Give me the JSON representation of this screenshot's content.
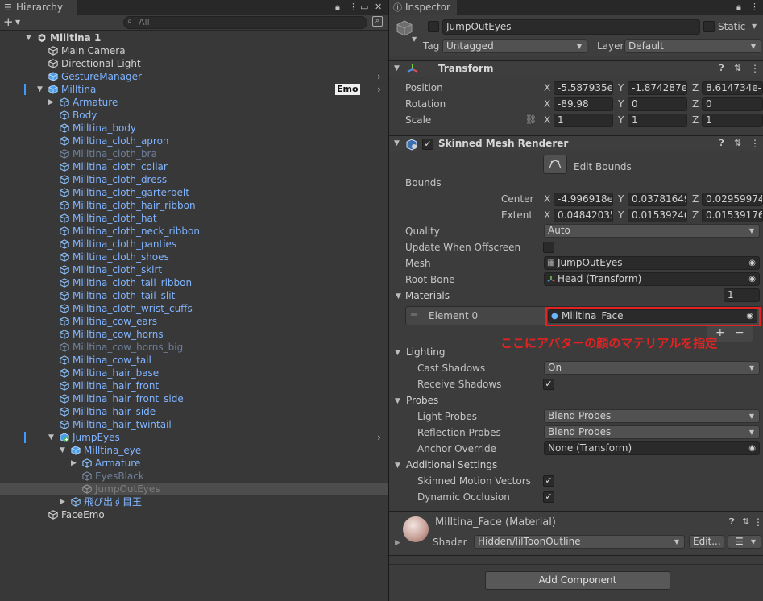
{
  "hierarchy": {
    "tab_title": "Hierarchy",
    "search_placeholder": "All",
    "badge": "Emo",
    "rows": [
      {
        "label": "Milltina 1",
        "indent": 0,
        "arrow": "down",
        "color": "white",
        "bold": true,
        "icon": "unity-scene-icon"
      },
      {
        "label": "Main Camera",
        "indent": 1,
        "arrow": "",
        "color": "white",
        "icon": "cube-outline-icon"
      },
      {
        "label": "Directional Light",
        "indent": 1,
        "arrow": "",
        "color": "white",
        "icon": "cube-outline-icon"
      },
      {
        "label": "GestureManager",
        "indent": 1,
        "arrow": "",
        "color": "blue",
        "icon": "cube-solid-icon",
        "chevron": true
      },
      {
        "label": "Milltina",
        "indent": 1,
        "arrow": "down",
        "color": "blue",
        "icon": "cube-solid-icon",
        "chevron": true,
        "badge": true,
        "marker": true
      },
      {
        "label": "Armature",
        "indent": 2,
        "arrow": "right",
        "color": "blue",
        "icon": "cube-outline-icon"
      },
      {
        "label": "Body",
        "indent": 2,
        "arrow": "",
        "color": "blue",
        "icon": "cube-outline-icon"
      },
      {
        "label": "Milltina_body",
        "indent": 2,
        "arrow": "",
        "color": "blue",
        "icon": "cube-outline-icon"
      },
      {
        "label": "Milltina_cloth_apron",
        "indent": 2,
        "arrow": "",
        "color": "blue",
        "icon": "cube-outline-icon"
      },
      {
        "label": "Milltina_cloth_bra",
        "indent": 2,
        "arrow": "",
        "color": "dim",
        "icon": "cube-outline-icon"
      },
      {
        "label": "Milltina_cloth_collar",
        "indent": 2,
        "arrow": "",
        "color": "blue",
        "icon": "cube-outline-icon"
      },
      {
        "label": "Milltina_cloth_dress",
        "indent": 2,
        "arrow": "",
        "color": "blue",
        "icon": "cube-outline-icon"
      },
      {
        "label": "Milltina_cloth_garterbelt",
        "indent": 2,
        "arrow": "",
        "color": "blue",
        "icon": "cube-outline-icon"
      },
      {
        "label": "Milltina_cloth_hair_ribbon",
        "indent": 2,
        "arrow": "",
        "color": "blue",
        "icon": "cube-outline-icon"
      },
      {
        "label": "Milltina_cloth_hat",
        "indent": 2,
        "arrow": "",
        "color": "blue",
        "icon": "cube-outline-icon"
      },
      {
        "label": "Milltina_cloth_neck_ribbon",
        "indent": 2,
        "arrow": "",
        "color": "blue",
        "icon": "cube-outline-icon"
      },
      {
        "label": "Milltina_cloth_panties",
        "indent": 2,
        "arrow": "",
        "color": "blue",
        "icon": "cube-outline-icon"
      },
      {
        "label": "Milltina_cloth_shoes",
        "indent": 2,
        "arrow": "",
        "color": "blue",
        "icon": "cube-outline-icon"
      },
      {
        "label": "Milltina_cloth_skirt",
        "indent": 2,
        "arrow": "",
        "color": "blue",
        "icon": "cube-outline-icon"
      },
      {
        "label": "Milltina_cloth_tail_ribbon",
        "indent": 2,
        "arrow": "",
        "color": "blue",
        "icon": "cube-outline-icon"
      },
      {
        "label": "Milltina_cloth_tail_slit",
        "indent": 2,
        "arrow": "",
        "color": "blue",
        "icon": "cube-outline-icon"
      },
      {
        "label": "Milltina_cloth_wrist_cuffs",
        "indent": 2,
        "arrow": "",
        "color": "blue",
        "icon": "cube-outline-icon"
      },
      {
        "label": "Milltina_cow_ears",
        "indent": 2,
        "arrow": "",
        "color": "blue",
        "icon": "cube-outline-icon"
      },
      {
        "label": "Milltina_cow_horns",
        "indent": 2,
        "arrow": "",
        "color": "blue",
        "icon": "cube-outline-icon"
      },
      {
        "label": "Milltina_cow_horns_big",
        "indent": 2,
        "arrow": "",
        "color": "dim",
        "icon": "cube-outline-icon"
      },
      {
        "label": "Milltina_cow_tail",
        "indent": 2,
        "arrow": "",
        "color": "blue",
        "icon": "cube-outline-icon"
      },
      {
        "label": "Milltina_hair_base",
        "indent": 2,
        "arrow": "",
        "color": "blue",
        "icon": "cube-outline-icon"
      },
      {
        "label": "Milltina_hair_front",
        "indent": 2,
        "arrow": "",
        "color": "blue",
        "icon": "cube-outline-icon"
      },
      {
        "label": "Milltina_hair_front_side",
        "indent": 2,
        "arrow": "",
        "color": "blue",
        "icon": "cube-outline-icon"
      },
      {
        "label": "Milltina_hair_side",
        "indent": 2,
        "arrow": "",
        "color": "blue",
        "icon": "cube-outline-icon"
      },
      {
        "label": "Milltina_hair_twintail",
        "indent": 2,
        "arrow": "",
        "color": "blue",
        "icon": "cube-outline-icon"
      },
      {
        "label": "JumpEyes",
        "indent": 2,
        "arrow": "down",
        "color": "blue",
        "icon": "prefab-add-icon",
        "chevron": true,
        "marker": true
      },
      {
        "label": "Milltina_eye",
        "indent": 3,
        "arrow": "down",
        "color": "blue",
        "icon": "cube-solid-icon"
      },
      {
        "label": "Armature",
        "indent": 4,
        "arrow": "right",
        "color": "blue",
        "icon": "cube-outline-icon"
      },
      {
        "label": "EyesBlack",
        "indent": 4,
        "arrow": "",
        "color": "dim",
        "icon": "cube-outline-icon"
      },
      {
        "label": "JumpOutEyes",
        "indent": 4,
        "arrow": "",
        "color": "grey",
        "icon": "cube-outline-icon",
        "selected": true
      },
      {
        "label": "飛び出す目玉",
        "indent": 3,
        "arrow": "right",
        "color": "blue",
        "icon": "cube-outline-icon"
      },
      {
        "label": "FaceEmo",
        "indent": 1,
        "arrow": "",
        "color": "white",
        "icon": "cube-outline-icon"
      }
    ]
  },
  "inspector": {
    "tab_title": "Inspector",
    "object_name": "JumpOutEyes",
    "static_label": "Static",
    "tag_label": "Tag",
    "tag_value": "Untagged",
    "layer_label": "Layer",
    "layer_value": "Default",
    "transform": {
      "title": "Transform",
      "position_label": "Position",
      "rotation_label": "Rotation",
      "scale_label": "Scale",
      "position": [
        "-5.587935e",
        "-1.874287e-",
        "8.614734e-"
      ],
      "rotation": [
        "-89.98",
        "0",
        "0"
      ],
      "scale": [
        "1",
        "1",
        "1"
      ]
    },
    "smr": {
      "title": "Skinned Mesh Renderer",
      "edit_bounds": "Edit Bounds",
      "bounds_label": "Bounds",
      "center_label": "Center",
      "extent_label": "Extent",
      "center": [
        "-4.996918e-",
        "0.03781649",
        "0.02959974"
      ],
      "extent": [
        "0.04842035",
        "0.01539246",
        "0.01539176"
      ],
      "quality_label": "Quality",
      "quality_value": "Auto",
      "update_offscreen_label": "Update When Offscreen",
      "mesh_label": "Mesh",
      "mesh_value": "JumpOutEyes",
      "root_bone_label": "Root Bone",
      "root_bone_value": "Head (Transform)",
      "materials_label": "Materials",
      "materials_count": "1",
      "element0_label": "Element 0",
      "element0_value": "Milltina_Face",
      "annotation": "ここにアバターの顔のマテリアルを指定",
      "lighting_label": "Lighting",
      "cast_shadows_label": "Cast Shadows",
      "cast_shadows_value": "On",
      "receive_shadows_label": "Receive Shadows",
      "probes_label": "Probes",
      "light_probes_label": "Light Probes",
      "light_probes_value": "Blend Probes",
      "reflection_probes_label": "Reflection Probes",
      "reflection_probes_value": "Blend Probes",
      "anchor_override_label": "Anchor Override",
      "anchor_override_value": "None (Transform)",
      "additional_label": "Additional Settings",
      "motion_vectors_label": "Skinned Motion Vectors",
      "dynamic_occlusion_label": "Dynamic Occlusion"
    },
    "material": {
      "title": "Milltina_Face (Material)",
      "shader_label": "Shader",
      "shader_value": "Hidden/lilToonOutline",
      "edit_label": "Edit..."
    },
    "add_component": "Add Component",
    "axes": [
      "X",
      "Y",
      "Z"
    ]
  },
  "colors": {
    "accent_blue": "#80b4ff",
    "annotation_red": "#e32222",
    "selection": "#4d4d4d"
  }
}
